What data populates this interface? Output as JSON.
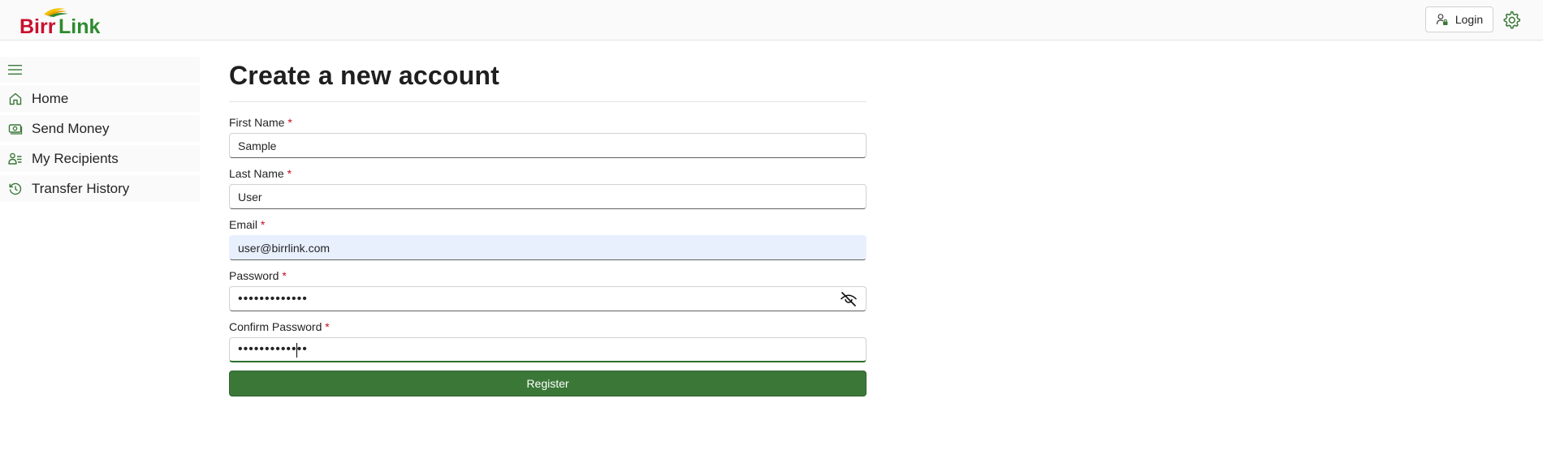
{
  "header": {
    "logo_text": "BirrLink",
    "login_label": "Login",
    "settings_icon": "gear-icon"
  },
  "sidebar": {
    "menu_icon": "hamburger-icon",
    "items": [
      {
        "label": "Home",
        "icon": "home-icon"
      },
      {
        "label": "Send Money",
        "icon": "money-icon"
      },
      {
        "label": "My Recipients",
        "icon": "people-icon"
      },
      {
        "label": "Transfer History",
        "icon": "history-icon"
      }
    ]
  },
  "form": {
    "title": "Create a new account",
    "required_mark": "*",
    "first_name": {
      "label": "First Name",
      "value": "Sample"
    },
    "last_name": {
      "label": "Last Name",
      "value": "User"
    },
    "email": {
      "label": "Email",
      "value": "user@birrlink.com"
    },
    "password": {
      "label": "Password",
      "value": "•••••••••••••"
    },
    "confirm_password": {
      "label": "Confirm Password",
      "value": "•••••••••••••"
    },
    "register_label": "Register"
  },
  "colors": {
    "brand_green": "#3b7838",
    "brand_red": "#c8102e",
    "required_red": "#c50f1f",
    "autofill_bg": "#e8f0fe"
  }
}
